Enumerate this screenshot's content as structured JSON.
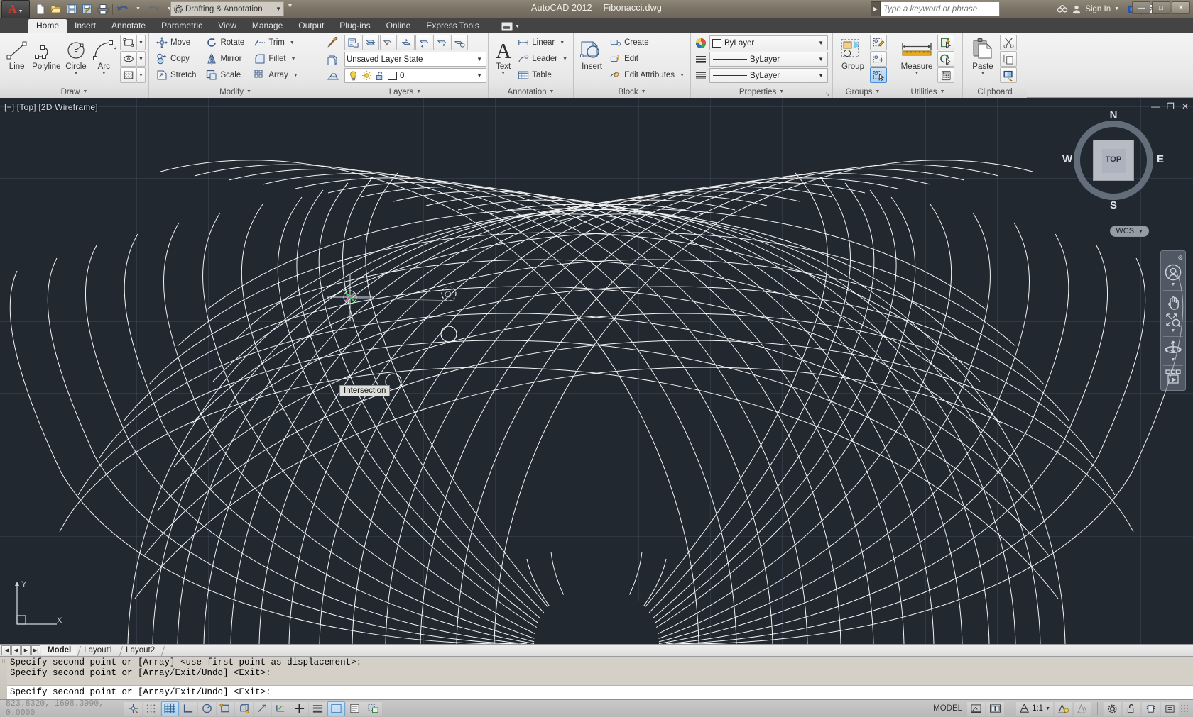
{
  "titlebar": {
    "app_title": "AutoCAD 2012",
    "file_name": "Fibonacci.dwg",
    "workspace": "Drafting & Annotation",
    "search_placeholder": "Type a keyword or phrase",
    "sign_in": "Sign In",
    "quick_access": [
      {
        "name": "new-icon",
        "label": "New"
      },
      {
        "name": "open-icon",
        "label": "Open"
      },
      {
        "name": "save-icon",
        "label": "Save"
      },
      {
        "name": "save-as-icon",
        "label": "Save As"
      },
      {
        "name": "plot-icon",
        "label": "Plot"
      },
      {
        "name": "undo-icon",
        "label": "Undo"
      },
      {
        "name": "redo-icon",
        "label": "Redo"
      }
    ],
    "window_buttons": [
      "minimize",
      "maximize",
      "close"
    ]
  },
  "ribbon": {
    "tabs": [
      {
        "label": "Home",
        "active": true
      },
      {
        "label": "Insert",
        "active": false
      },
      {
        "label": "Annotate",
        "active": false
      },
      {
        "label": "Parametric",
        "active": false
      },
      {
        "label": "View",
        "active": false
      },
      {
        "label": "Manage",
        "active": false
      },
      {
        "label": "Output",
        "active": false
      },
      {
        "label": "Plug-ins",
        "active": false
      },
      {
        "label": "Online",
        "active": false
      },
      {
        "label": "Express Tools",
        "active": false
      }
    ],
    "panels": {
      "draw": {
        "title": "Draw",
        "big": [
          {
            "label": "Line",
            "icon": "line-icon",
            "caret": false
          },
          {
            "label": "Polyline",
            "icon": "polyline-icon",
            "caret": false
          },
          {
            "label": "Circle",
            "icon": "circle-icon",
            "caret": true
          },
          {
            "label": "Arc",
            "icon": "arc-icon",
            "caret": true
          }
        ],
        "small": [
          {
            "icon": "rectangle-icon",
            "label": "Rectangle"
          },
          {
            "icon": "ellipse-icon",
            "label": "Ellipse"
          },
          {
            "icon": "hatch-icon",
            "label": "Hatch"
          }
        ]
      },
      "modify": {
        "title": "Modify",
        "items": [
          {
            "label": "Move",
            "icon": "move-icon",
            "caret": false
          },
          {
            "label": "Rotate",
            "icon": "rotate-icon",
            "caret": false
          },
          {
            "label": "Trim",
            "icon": "trim-icon",
            "caret": true
          },
          {
            "label": "Copy",
            "icon": "copy-icon",
            "caret": false
          },
          {
            "label": "Mirror",
            "icon": "mirror-icon",
            "caret": false
          },
          {
            "label": "Fillet",
            "icon": "fillet-icon",
            "caret": true
          },
          {
            "label": "Stretch",
            "icon": "stretch-icon",
            "caret": false
          },
          {
            "label": "Scale",
            "icon": "scale-icon",
            "caret": false
          },
          {
            "label": "Array",
            "icon": "array-icon",
            "caret": true
          }
        ]
      },
      "layers": {
        "title": "Layers",
        "layer_state": "Unsaved Layer State",
        "current_layer": "0",
        "left_icons": [
          "layer-properties-icon",
          "layer-isolate-icon",
          "layer-freeze-icon"
        ],
        "tool_icons": [
          "layer-props-manager-icon",
          "layer-merge-icon",
          "layer-match-icon",
          "layer-change-icon",
          "layer-previous-icon",
          "layer-make-current-icon",
          "layer-off-icon",
          "layer-walk-icon"
        ],
        "status_icons": [
          "lightbulb-on-icon",
          "sun-icon",
          "unlock-icon",
          "color-swatch-icon"
        ]
      },
      "annotation": {
        "title": "Annotation",
        "big": {
          "label": "Text",
          "icon": "text-icon",
          "caret": true
        },
        "items": [
          {
            "label": "Linear",
            "icon": "linear-dimension-icon",
            "caret": true
          },
          {
            "label": "Leader",
            "icon": "leader-icon",
            "caret": true
          },
          {
            "label": "Table",
            "icon": "table-icon",
            "caret": false
          }
        ]
      },
      "block": {
        "title": "Block",
        "big": {
          "label": "Insert",
          "icon": "insert-block-icon",
          "caret": false
        },
        "items": [
          {
            "label": "Create",
            "icon": "create-block-icon",
            "caret": false
          },
          {
            "label": "Edit",
            "icon": "edit-block-icon",
            "caret": false
          },
          {
            "label": "Edit Attributes",
            "icon": "edit-attributes-icon",
            "caret": true
          }
        ]
      },
      "properties": {
        "title": "Properties",
        "rows": [
          {
            "icon": "color-wheel-icon",
            "value": "ByLayer",
            "swatch": "#ffffff"
          },
          {
            "icon": "linetype-icon",
            "value": "ByLayer",
            "line": "solid"
          },
          {
            "icon": "lineweight-icon",
            "value": "ByLayer",
            "line": "solid"
          }
        ]
      },
      "groups": {
        "title": "Groups",
        "big": {
          "label": "Group",
          "icon": "group-icon"
        },
        "small": [
          {
            "icon": "ungroup-icon",
            "selected": false
          },
          {
            "icon": "group-edit-icon",
            "selected": false
          },
          {
            "icon": "group-selection-on-icon",
            "selected": true
          }
        ]
      },
      "utilities": {
        "title": "Utilities",
        "big": {
          "label": "Measure",
          "icon": "measure-icon",
          "caret": true
        },
        "small": [
          {
            "icon": "quick-select-icon"
          },
          {
            "icon": "quick-calc-cursor-icon"
          },
          {
            "icon": "calculator-icon"
          }
        ]
      },
      "clipboard": {
        "title": "Clipboard",
        "big": {
          "label": "Paste",
          "icon": "paste-icon",
          "caret": true
        },
        "small": [
          {
            "icon": "cut-icon"
          },
          {
            "icon": "copy-clip-icon"
          },
          {
            "icon": "copy-with-basepoint-icon"
          }
        ]
      }
    }
  },
  "viewport": {
    "label": "[−] [Top] [2D Wireframe]",
    "viewcube": {
      "top": "TOP",
      "north": "N",
      "south": "S",
      "east": "E",
      "west": "W"
    },
    "wcs_label": "WCS",
    "osnap_tooltip": "Intersection",
    "ucs": {
      "x": "X",
      "y": "Y"
    },
    "background_color": "#212830",
    "geometry_color": "#ffffff",
    "nav_icons": [
      "close-icon",
      "steering-wheel-icon",
      "pan-hand-icon",
      "zoom-extents-icon",
      "orbit-icon",
      "showmotion-icon"
    ]
  },
  "layout_tabs": {
    "nav": [
      "first",
      "prev",
      "next",
      "last"
    ],
    "tabs": [
      {
        "label": "Model",
        "active": true
      },
      {
        "label": "Layout1",
        "active": false
      },
      {
        "label": "Layout2",
        "active": false
      }
    ]
  },
  "command_line": {
    "history": [
      "Specify second point or [Array] <use first point as displacement>:",
      "Specify second point or [Array/Exit/Undo] <Exit>:"
    ],
    "current": "Specify second point or [Array/Exit/Undo] <Exit>:"
  },
  "statusbar": {
    "coordinates": "823.8320, 1698.3990, 0.0000",
    "toggles": [
      {
        "name": "infer-constraints-icon",
        "on": false
      },
      {
        "name": "snap-mode-icon",
        "on": false
      },
      {
        "name": "grid-display-icon",
        "on": true
      },
      {
        "name": "ortho-mode-icon",
        "on": false
      },
      {
        "name": "polar-tracking-icon",
        "on": false
      },
      {
        "name": "object-snap-icon",
        "on": false
      },
      {
        "name": "3d-object-snap-icon",
        "on": false
      },
      {
        "name": "object-snap-tracking-icon",
        "on": false
      },
      {
        "name": "dynamic-ucs-icon",
        "on": false
      },
      {
        "name": "dynamic-input-icon",
        "on": false
      },
      {
        "name": "lineweight-icon",
        "on": false
      },
      {
        "name": "transparency-icon",
        "on": true
      },
      {
        "name": "quick-properties-icon",
        "on": false
      },
      {
        "name": "selection-cycling-icon",
        "on": false
      }
    ],
    "model_label": "MODEL",
    "annotation_scale": "1:1",
    "right_icons": [
      "model-space-icon",
      "layout-space-icon",
      "annotation-visibility-icon",
      "auto-scale-icon",
      "workspace-gear-icon",
      "lock-toolbars-icon",
      "hardware-accel-icon",
      "clean-screen-icon"
    ]
  }
}
